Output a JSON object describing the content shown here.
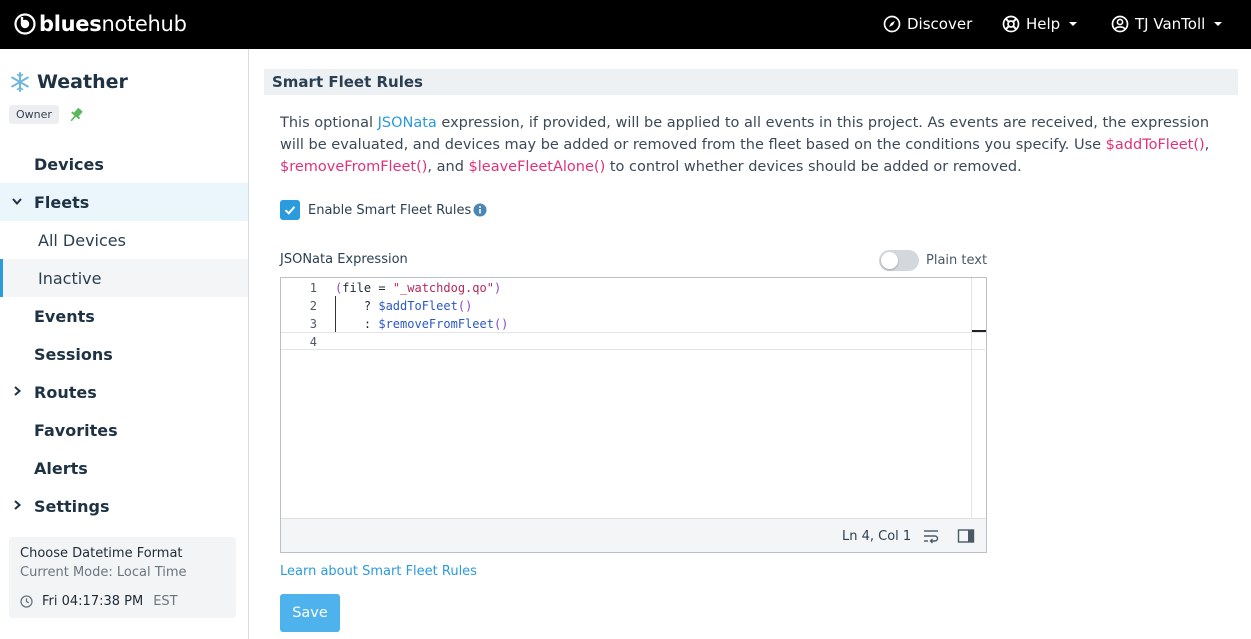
{
  "brand": {
    "bold": "blues",
    "light": "notehub"
  },
  "topnav": {
    "discover": "Discover",
    "help": "Help",
    "user": "TJ VanToll"
  },
  "project": {
    "name": "Weather",
    "role": "Owner"
  },
  "sidebar": {
    "items": [
      {
        "label": "Devices"
      },
      {
        "label": "Fleets"
      },
      {
        "label": "All Devices"
      },
      {
        "label": "Inactive"
      },
      {
        "label": "Events"
      },
      {
        "label": "Sessions"
      },
      {
        "label": "Routes"
      },
      {
        "label": "Favorites"
      },
      {
        "label": "Alerts"
      },
      {
        "label": "Settings"
      }
    ],
    "datetime": {
      "title": "Choose Datetime Format",
      "mode": "Current Mode: Local Time",
      "time": "Fri 04:17:38 PM",
      "tz": "EST"
    }
  },
  "main": {
    "section_title": "Smart Fleet Rules",
    "desc": {
      "p1": "This optional ",
      "link": "JSONata",
      "p2": " expression, if provided, will be applied to all events in this project. As events are received, the expression will be evaluated, and devices may be added or removed from the fleet based on the conditions you specify. Use ",
      "fn1": "$addToFleet()",
      "p3": ", ",
      "fn2": "$removeFromFleet()",
      "p4": ", and ",
      "fn3": "$leaveFleetAlone()",
      "p5": " to control whether devices should be added or removed."
    },
    "enable_label": "Enable Smart Fleet Rules",
    "expression_label": "JSONata Expression",
    "plain_text_label": "Plain text",
    "editor": {
      "line_numbers": [
        "1",
        "2",
        "3",
        "4"
      ],
      "lines": {
        "l1_open": "(",
        "l1_mid": "file = ",
        "l1_str": "\"_watchdog.qo\"",
        "l1_close": ")",
        "l2_prefix": "    ? ",
        "l2_fn": "$addToFleet",
        "l2_parens": "()",
        "l3_prefix": "    : ",
        "l3_fn": "$removeFromFleet",
        "l3_parens": "()"
      },
      "status": "Ln 4, Col 1"
    },
    "learn_link": "Learn about Smart Fleet Rules",
    "save_label": "Save"
  },
  "colors": {
    "accent": "#2a9bdc",
    "function_pink": "#e0327c",
    "save_button": "#4eb2ec",
    "pin_green": "#5cb85c"
  }
}
